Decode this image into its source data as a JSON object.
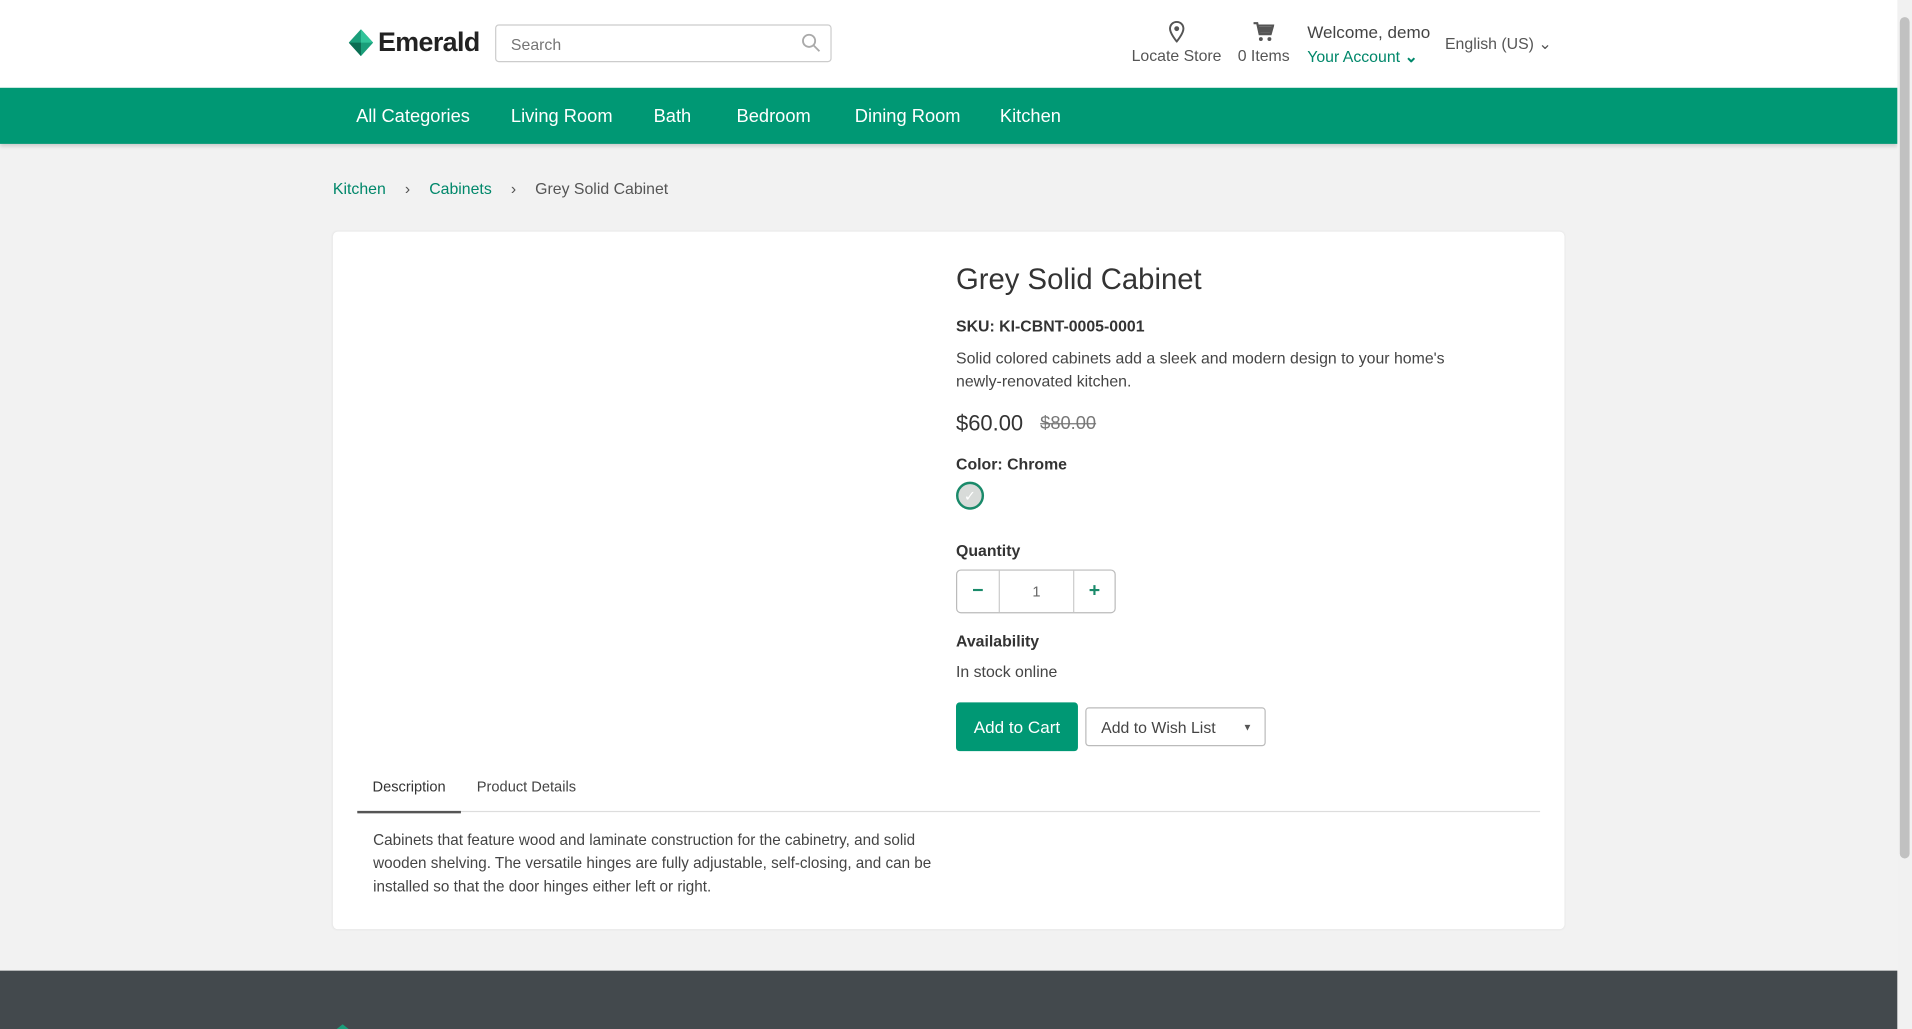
{
  "header": {
    "brand": "Emerald",
    "search_placeholder": "Search",
    "locate_store": "Locate Store",
    "cart_items": "0 Items",
    "welcome": "Welcome, demo",
    "account": "Your Account",
    "language": "English (US)"
  },
  "nav": {
    "items": [
      "All Categories",
      "Living Room",
      "Bath",
      "Bedroom",
      "Dining Room",
      "Kitchen"
    ]
  },
  "breadcrumb": [
    "Kitchen",
    "Cabinets",
    "Grey Solid Cabinet"
  ],
  "product": {
    "title": "Grey Solid Cabinet",
    "sku": "SKU: KI-CBNT-0005-0001",
    "summary": "Solid colored cabinets add a sleek and modern design to your home's newly-renovated kitchen.",
    "price": "$60.00",
    "old_price": "$80.00",
    "color_label": "Color: Chrome",
    "quantity_label": "Quantity",
    "quantity": "1",
    "availability_label": "Availability",
    "availability": "In stock online",
    "add_to_cart": "Add to Cart",
    "wish_list": "Add to Wish List"
  },
  "tabs": {
    "items": [
      "Description",
      "Product Details"
    ],
    "description": "Cabinets that feature wood and laminate construction for the cabinetry, and solid wooden shelving. The versatile hinges are fully adjustable, self-closing, and can be installed so that the door hinges either left or right."
  },
  "colors": {
    "brand": "#009874",
    "link": "#00876a",
    "footer": "#43494d"
  }
}
